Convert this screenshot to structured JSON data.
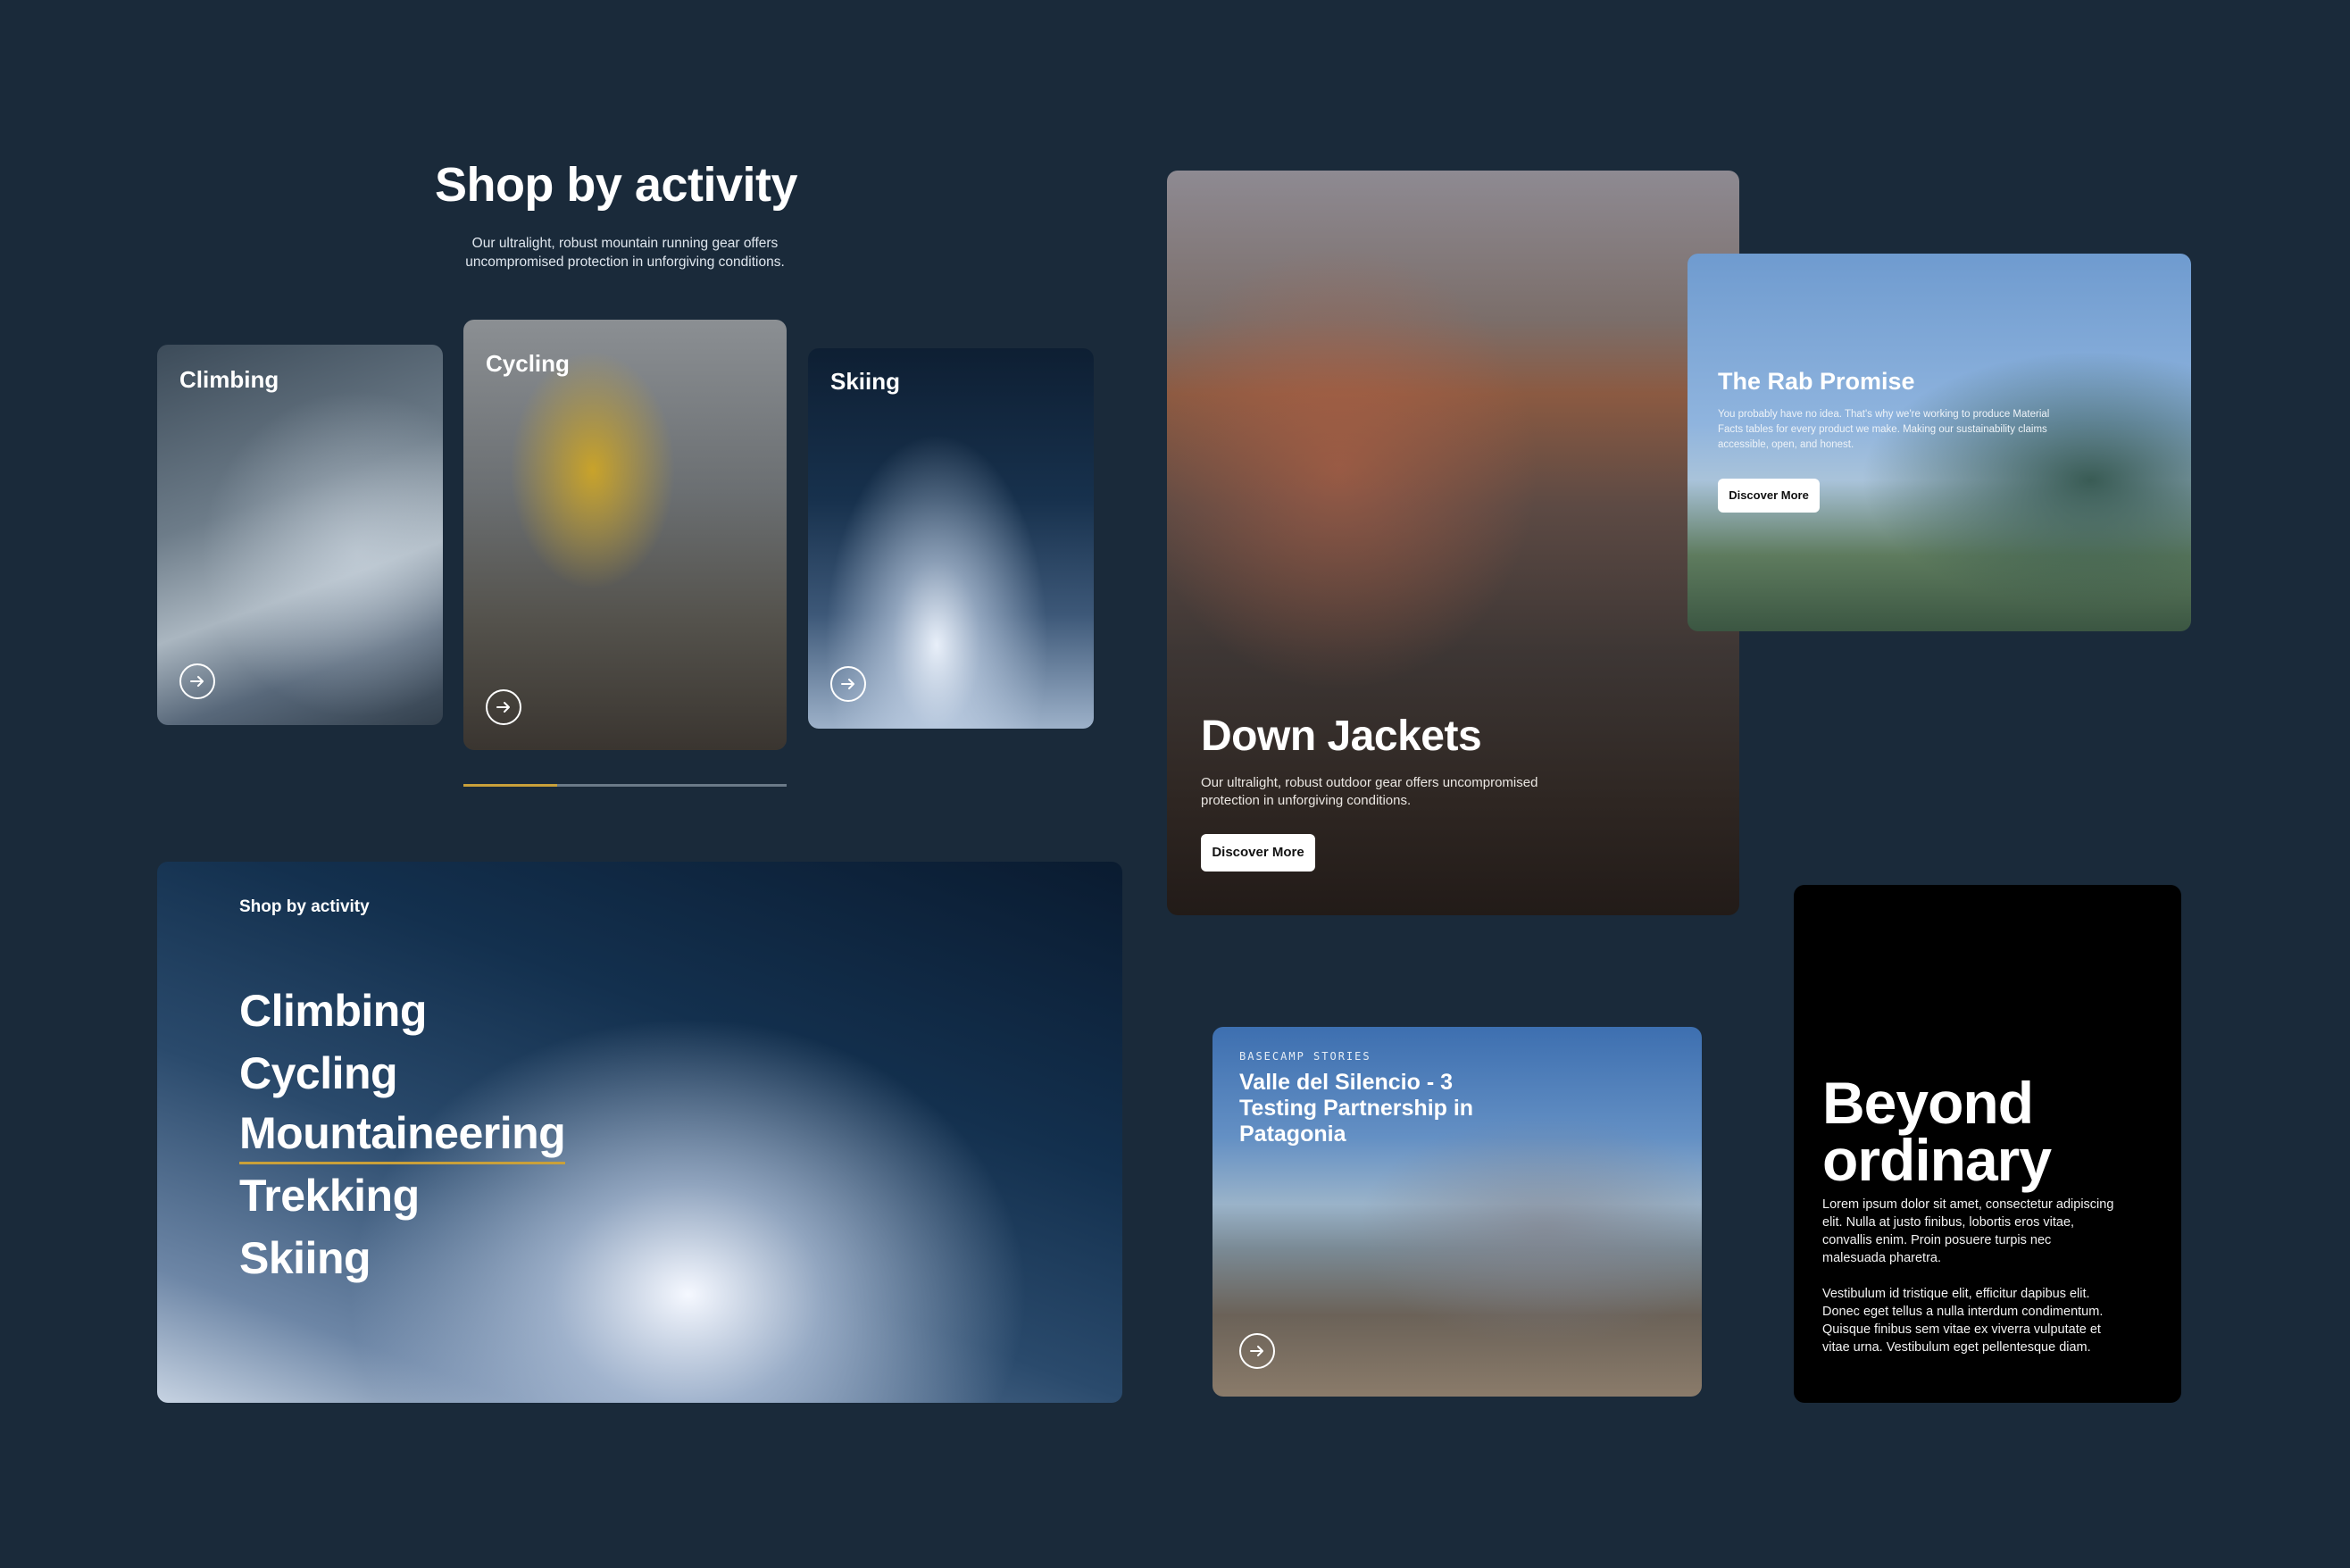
{
  "shop_section": {
    "title": "Shop by activity",
    "description": "Our ultralight, robust mountain running gear offers uncompromised protection in unforgiving conditions.",
    "cards": [
      {
        "label": "Climbing"
      },
      {
        "label": "Cycling"
      },
      {
        "label": "Skiing"
      }
    ],
    "carousel_progress": 0.29,
    "accent_color": "#c9a03a"
  },
  "banner": {
    "kicker": "Shop by activity",
    "items": [
      "Climbing",
      "Cycling",
      "Mountaineering",
      "Trekking",
      "Skiing"
    ],
    "active_item": "Mountaineering"
  },
  "down_jackets": {
    "title": "Down Jackets",
    "description": "Our ultralight, robust outdoor gear offers uncompromised protection in unforgiving conditions.",
    "button": "Discover More"
  },
  "rab_promise": {
    "title": "The Rab Promise",
    "description": "You probably have no idea. That's why we're working to produce Material Facts tables for every product we make. Making our sustainability claims accessible, open, and honest.",
    "button": "Discover More"
  },
  "basecamp": {
    "kicker": "BASECAMP STORIES",
    "title": "Valle del Silencio - 3 Testing Partnership in Patagonia"
  },
  "beyond": {
    "title_line1": "Beyond",
    "title_line2": "ordinary",
    "paragraph1": "Lorem ipsum dolor sit amet, consectetur adipiscing elit. Nulla at justo finibus, lobortis eros vitae, convallis enim. Proin posuere turpis nec malesuada pharetra.",
    "paragraph2": "Vestibulum id tristique elit, efficitur dapibus elit. Donec eget tellus a nulla interdum condimentum. Quisque finibus sem vitae ex viverra vulputate et vitae urna. Vestibulum eget pellentesque diam."
  },
  "icons": {
    "card_arrow": "arrow-right-circle-icon"
  },
  "colors": {
    "page_background": "#1a2a3a",
    "beyond_background": "#000000"
  }
}
